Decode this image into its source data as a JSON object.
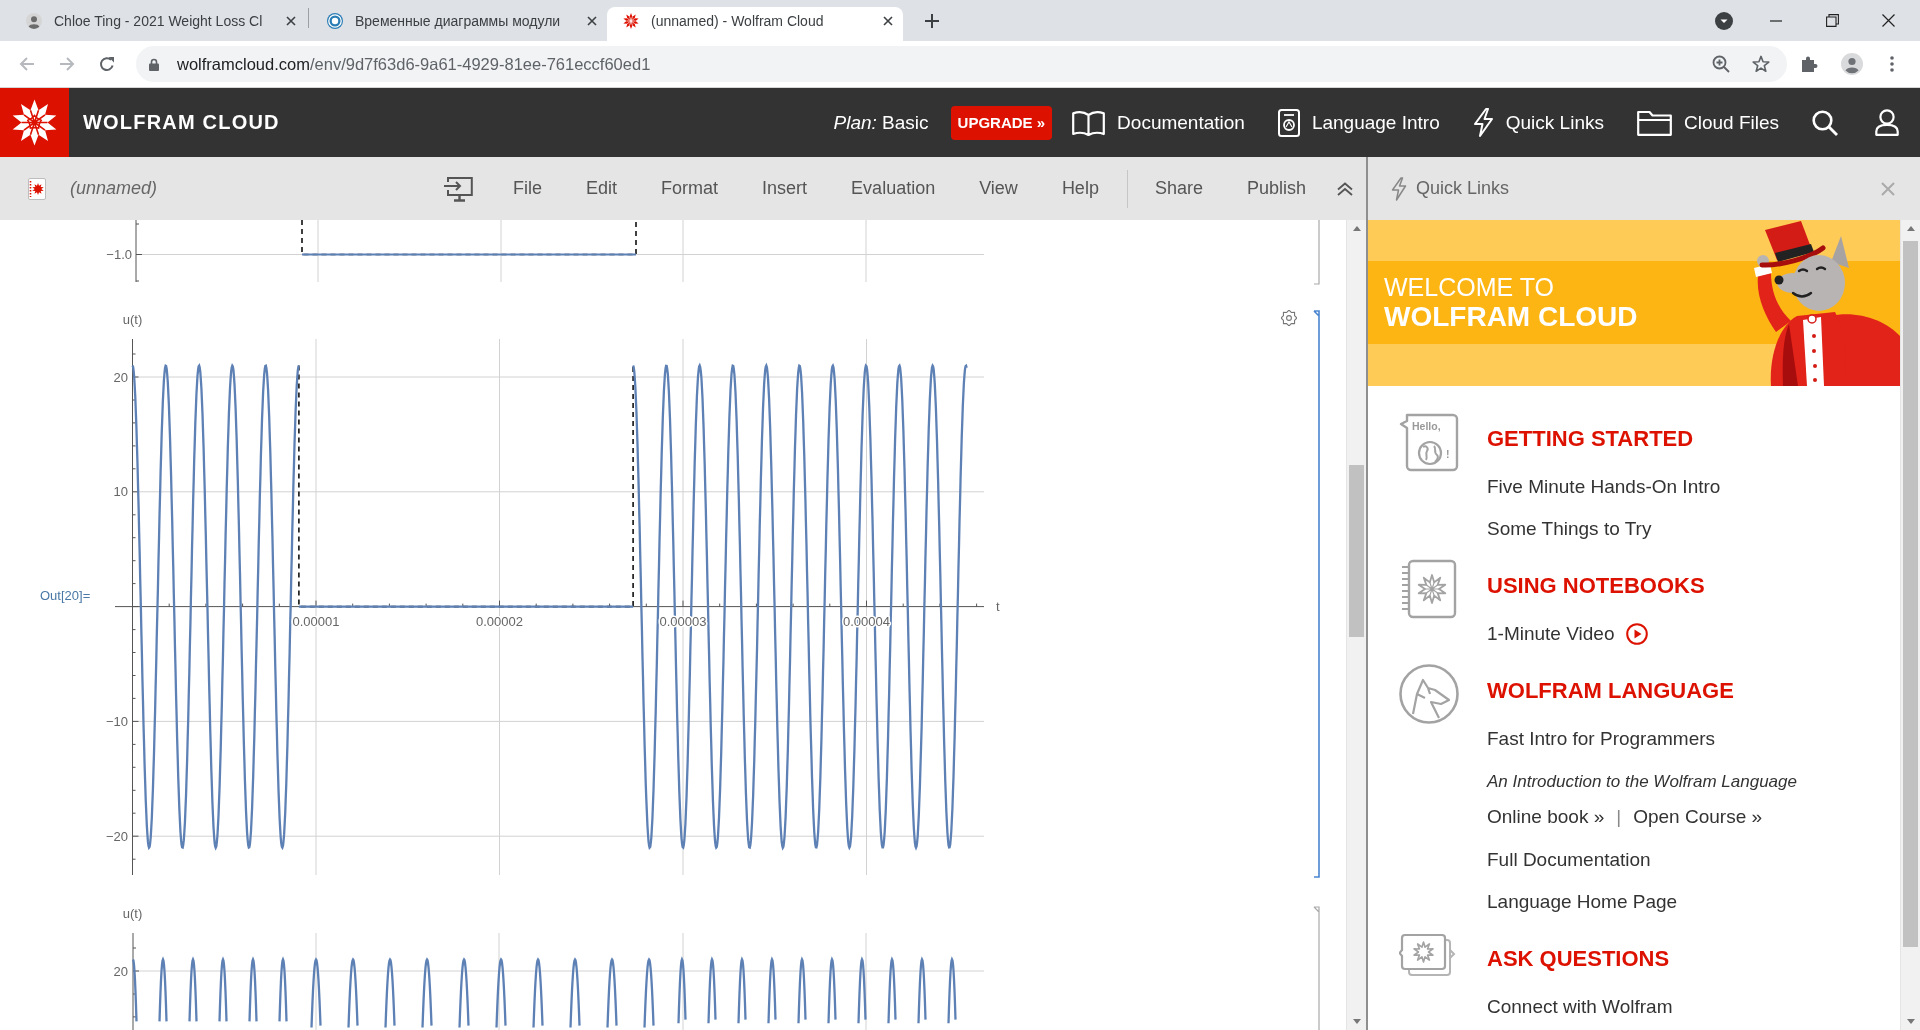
{
  "browser": {
    "tabs": [
      {
        "title": "Chloe Ting - 2021 Weight Loss Cl",
        "selected": false
      },
      {
        "title": "Временные диаграммы модули",
        "selected": false
      },
      {
        "title": "(unnamed) - Wolfram Cloud",
        "selected": true
      }
    ],
    "url": {
      "host": "wolframcloud.com",
      "path": "/env/9d7f63d6-9a61-4929-81ee-761eccf60ed1"
    }
  },
  "header": {
    "brand": "WOLFRAM CLOUD",
    "plan": "*Plan:* Basic",
    "upgrade": "UPGRADE »",
    "nav": [
      "Documentation",
      "Language Intro",
      "Quick Links",
      "Cloud Files"
    ]
  },
  "toolbar": {
    "notebook_title": "(unnamed)",
    "menus": [
      "File",
      "Edit",
      "Format",
      "Insert",
      "Evaluation",
      "View",
      "Help"
    ],
    "actions": [
      "Share",
      "Publish"
    ]
  },
  "notebook": {
    "cells": [
      {
        "kind": "step",
        "selected": false,
        "plot": {
          "y_ticks": [
            "−1.0"
          ]
        }
      },
      {
        "kind": "burst",
        "selected": true,
        "output_label": "Out[20]=",
        "plot": {
          "y_label": "u(t)",
          "x_label": "t",
          "x_ticks": [
            "0.00001",
            "0.00002",
            "0.00003",
            "0.00004"
          ],
          "y_ticks": [
            "20",
            "10",
            "−10",
            "−20"
          ]
        }
      },
      {
        "kind": "shift",
        "selected": false,
        "plot": {
          "y_label": "u(t)",
          "y_ticks": [
            "20"
          ]
        }
      }
    ]
  },
  "quick_links": {
    "title": "Quick Links",
    "banner": {
      "line_1": "WELCOME TO",
      "line_2": "WOLFRAM CLOUD"
    },
    "sections": [
      {
        "heading": "GETTING STARTED",
        "icon_texts": [
          "Hello,",
          "!"
        ],
        "items": [
          {
            "kind": "link",
            "text": "Five Minute Hands-On Intro"
          },
          {
            "kind": "link",
            "text": "Some Things to Try"
          }
        ]
      },
      {
        "heading": "USING NOTEBOOKS",
        "items": [
          {
            "kind": "video",
            "text": "1-Minute Video"
          }
        ]
      },
      {
        "heading": "WOLFRAM LANGUAGE",
        "items": [
          {
            "kind": "link",
            "text": "Fast Intro for Programmers"
          },
          {
            "kind": "note",
            "text": "An Introduction to the Wolfram Language"
          },
          {
            "kind": "pair",
            "links": [
              "Online book »",
              "Open Course »"
            ],
            "separator": "|"
          },
          {
            "kind": "link",
            "text": "Full Documentation"
          },
          {
            "kind": "link",
            "text": "Language Home Page"
          }
        ]
      },
      {
        "heading": "ASK QUESTIONS",
        "items": [
          {
            "kind": "link",
            "text": "Connect with Wolfram"
          }
        ]
      }
    ]
  }
}
